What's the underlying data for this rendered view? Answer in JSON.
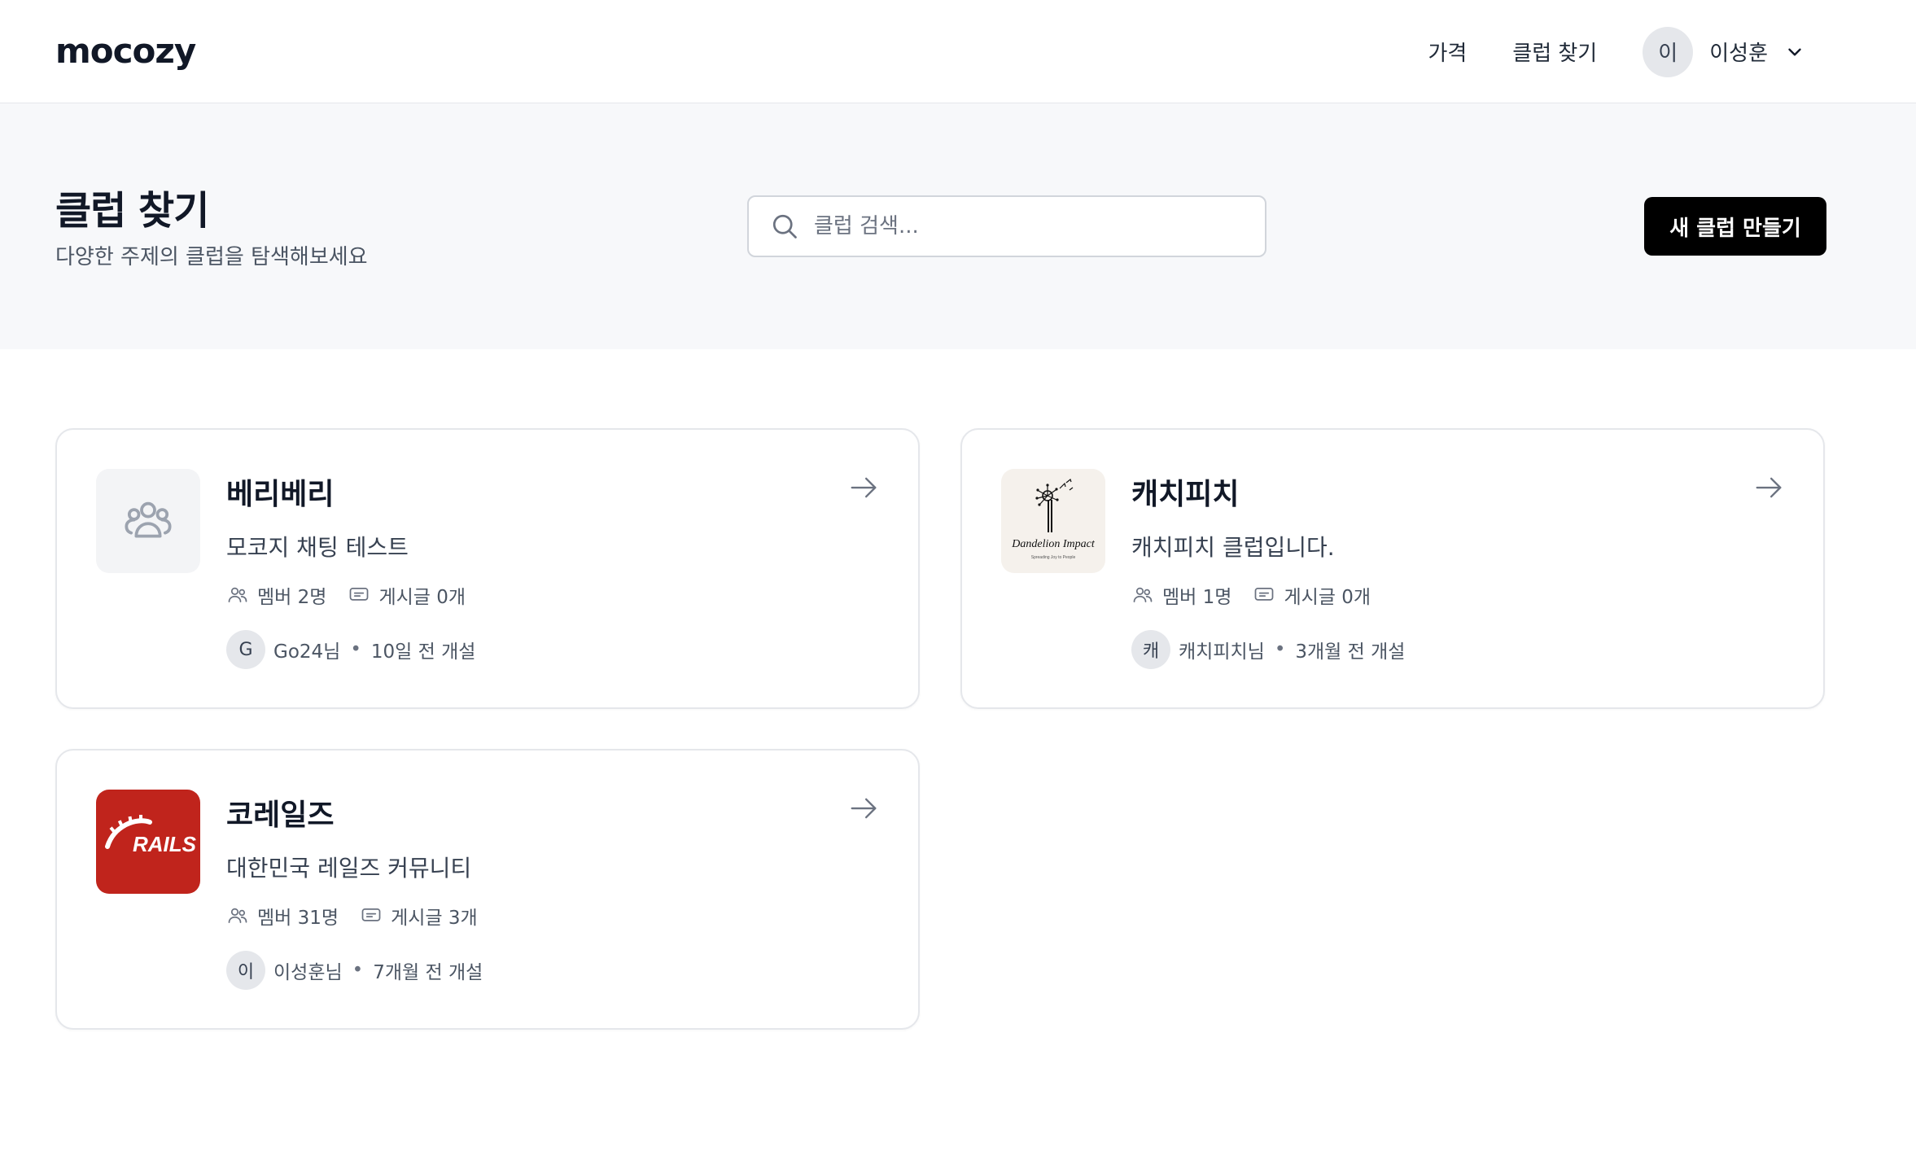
{
  "header": {
    "logo": "mocozy",
    "nav": [
      "가격",
      "클럽 찾기"
    ],
    "user": {
      "avatar": "이",
      "name": "이성훈"
    }
  },
  "hero": {
    "title": "클럽 찾기",
    "subtitle": "다양한 주제의 클럽을 탐색해보세요",
    "search_placeholder": "클럽 검색...",
    "search_value": "",
    "new_button": "새 클럽 만들기"
  },
  "clubs": [
    {
      "name": "베리베리",
      "description": "모코지 채팅 테스트",
      "thumbnail": "people-icon",
      "members": "멤버 2명",
      "posts": "게시글 0개",
      "owner_avatar": "G",
      "owner": "Go24님",
      "created": "10일 전 개설"
    },
    {
      "name": "캐치피치",
      "description": "캐치피치 클럽입니다.",
      "thumbnail": "dandelion-impact-logo",
      "thumbnail_text": "Dandelion Impact",
      "thumbnail_subtext": "Spreading Joy to People",
      "members": "멤버 1명",
      "posts": "게시글 0개",
      "owner_avatar": "캐",
      "owner": "캐치피치님",
      "created": "3개월 전 개설"
    },
    {
      "name": "코레일즈",
      "description": "대한민국 레일즈 커뮤니티",
      "thumbnail": "rails-logo",
      "thumbnail_text": "RAILS",
      "members": "멤버 31명",
      "posts": "게시글 3개",
      "owner_avatar": "이",
      "owner": "이성훈님",
      "created": "7개월 전 개설"
    }
  ],
  "colors": {
    "primary_button": "#000000",
    "hero_bg": "#f7f8fa",
    "rails_red": "#c0241c"
  }
}
